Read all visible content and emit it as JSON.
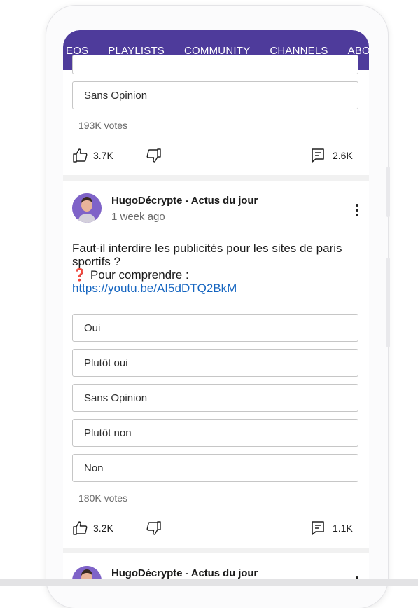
{
  "tabs": [
    "EOS",
    "PLAYLISTS",
    "COMMUNITY",
    "CHANNELS",
    "ABO"
  ],
  "active_tab": "COMMUNITY",
  "post1": {
    "visible_option": "Sans Opinion",
    "votes": "193K votes",
    "likes": "3.7K",
    "comments": "2.6K"
  },
  "post2": {
    "author": "HugoDécrypte - Actus du jour",
    "time": "1 week ago",
    "text_line": "Faut-il interdire les publicités pour les sites de paris sportifs ?",
    "emoji": "❓",
    "text_prefix": " Pour comprendre : ",
    "link": "https://youtu.be/AI5dDTQ2BkM",
    "options": [
      "Oui",
      "Plutôt oui",
      "Sans Opinion",
      "Plutôt non",
      "Non"
    ],
    "votes": "180K votes",
    "likes": "3.2K",
    "comments": "1.1K"
  },
  "post3": {
    "author": "HugoDécrypte - Actus du jour"
  },
  "colors": {
    "appbar": "#4e3b9b",
    "link": "#1565c0"
  },
  "icons": [
    "like-icon",
    "dislike-icon",
    "comment-icon",
    "more-vert-icon",
    "avatar"
  ]
}
